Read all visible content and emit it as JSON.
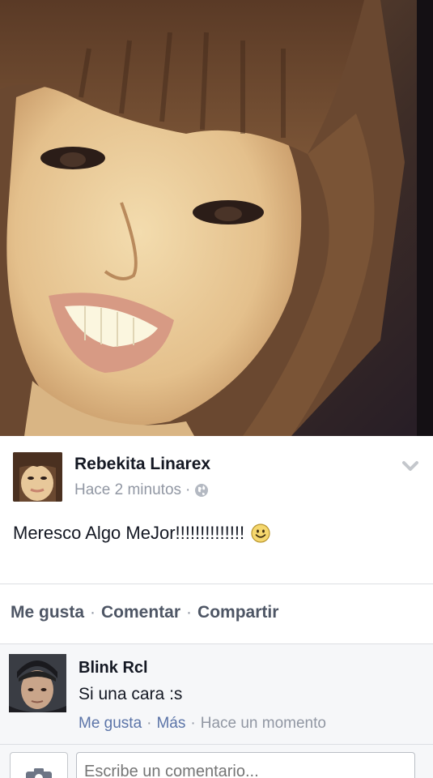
{
  "post": {
    "author": "Rebekita Linarex",
    "time": "Hace 2 minutos",
    "time_separator": "·",
    "text": "Meresco Algo MeJor!!!!!!!!!!!!!!"
  },
  "actions": {
    "like": "Me gusta",
    "comment": "Comentar",
    "share": "Compartir",
    "separator": "·"
  },
  "comment": {
    "author": "Blink Rcl",
    "text": "Si una cara :s",
    "like": "Me gusta",
    "more": "Más",
    "time": "Hace un momento",
    "separator": "·"
  },
  "composer": {
    "placeholder": "Escribe un comentario..."
  },
  "icons": {
    "privacy": "globe-icon",
    "menu": "chevron-down-icon",
    "emoji": "smiley-icon",
    "photo": "camera-icon"
  },
  "colors": {
    "link": "#5b74a8",
    "meta": "#9197a3",
    "text": "#141823",
    "action": "#4e5665"
  }
}
